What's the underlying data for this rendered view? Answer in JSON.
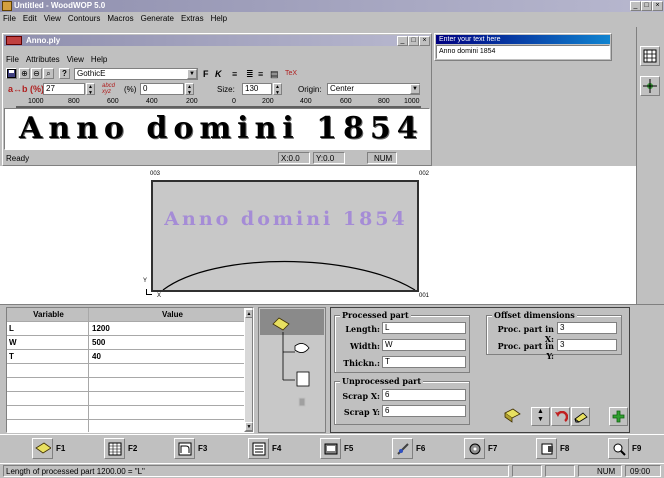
{
  "app": {
    "title": "Untitled - WoodWOP 5.0",
    "menu": [
      "File",
      "Edit",
      "View",
      "Contours",
      "Macros",
      "Generate",
      "Extras",
      "Help"
    ],
    "window_buttons": [
      "_",
      "□",
      "×"
    ]
  },
  "editor": {
    "title": "Anno.ply",
    "menu": [
      "File",
      "Attributes",
      "View",
      "Help"
    ],
    "font_name": "GothicE",
    "bold_label": "F",
    "italic_label": "K",
    "tex_label": "TeX",
    "spacing_label": "a↔b (%)",
    "spacing_value": "27",
    "stretch_label": "(%)",
    "stretch_value": "0",
    "size_label": "Size:",
    "size_value": "130",
    "origin_label": "Origin:",
    "origin_value": "Center",
    "ruler_labels": [
      "1000",
      "800",
      "600",
      "400",
      "200",
      "0",
      "200",
      "400",
      "600",
      "800",
      "1000"
    ],
    "preview_text": "Anno domini 1854",
    "status_text": "Ready",
    "status_x": "X:0.0",
    "status_y": "Y:0.0",
    "status_num": "NUM"
  },
  "text_input": {
    "title": "Enter your text here",
    "value": "Anno domini 1854"
  },
  "canvas": {
    "text": "Anno domini 1854",
    "corner_tl": "003",
    "corner_tr": "002",
    "corner_br": "001",
    "axis_y": "Y",
    "axis_x": "X"
  },
  "variables": {
    "header_variable": "Variable",
    "header_value": "Value",
    "rows": [
      {
        "name": "L",
        "value": "1200"
      },
      {
        "name": "W",
        "value": "500"
      },
      {
        "name": "T",
        "value": "40"
      },
      {
        "name": "",
        "value": ""
      },
      {
        "name": "",
        "value": ""
      },
      {
        "name": "",
        "value": ""
      },
      {
        "name": "",
        "value": ""
      },
      {
        "name": "",
        "value": ""
      }
    ]
  },
  "properties": {
    "processed_title": "Processed part",
    "length_label": "Length:",
    "length_value": "L",
    "width_label": "Width:",
    "width_value": "W",
    "thickness_label": "Thickn.:",
    "thickness_value": "T",
    "unprocessed_title": "Unprocessed part",
    "scrap_x_label": "Scrap X:",
    "scrap_x_value": "6",
    "scrap_y_label": "Scrap Y:",
    "scrap_y_value": "6",
    "offset_title": "Offset dimensions",
    "offset_x_label": "Proc. part in X:",
    "offset_x_value": "3",
    "offset_y_label": "Proc. part in Y:",
    "offset_y_value": "3"
  },
  "function_keys": [
    "F1",
    "F2",
    "F3",
    "F4",
    "F5",
    "F6",
    "F7",
    "F8",
    "F9"
  ],
  "statusbar": {
    "message": "Length of processed part 1200.00 = \"L\"",
    "num": "NUM",
    "time": "09:00"
  },
  "colors": {
    "canvas_text": "#a58cd6",
    "title_active": "#000080",
    "title_inactive": "#8f8fae"
  }
}
